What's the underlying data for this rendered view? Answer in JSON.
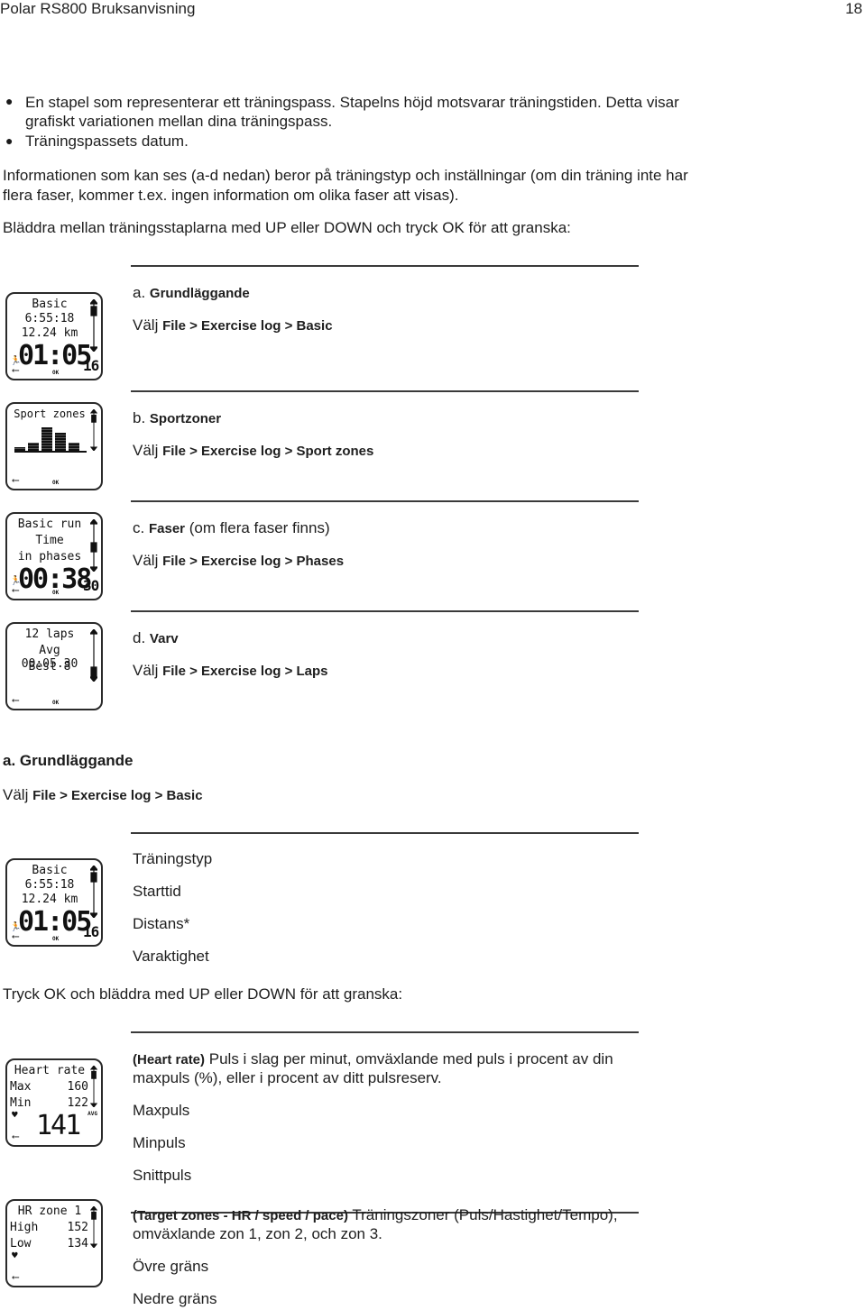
{
  "header": {
    "title": "Polar RS800 Bruksanvisning",
    "page_number": "18"
  },
  "intro": {
    "bullets": [
      "En stapel som representerar ett träningspass. Stapelns höjd motsvarar träningstiden. Detta visar",
      "grafiskt variationen mellan dina träningspass.",
      "Träningspassets datum."
    ],
    "para1_line1": "Informationen som kan ses (a-d nedan) beror på träningstyp och inställningar (om din träning inte har",
    "para1_line2": "flera faser, kommer t.ex. ingen information om olika faser att visas).",
    "para2": "Bläddra mellan träningsstaplarna med UP eller DOWN och tryck OK för att granska:"
  },
  "options": [
    {
      "letter": "a.",
      "title": "Grundläggande",
      "extra": "",
      "choose": "Välj",
      "path": "File > Exercise log > Basic"
    },
    {
      "letter": "b.",
      "title": "Sportzoner",
      "extra": "",
      "choose": "Välj",
      "path": "File > Exercise log > Sport zones"
    },
    {
      "letter": "c.",
      "title": "Faser",
      "extra": "(om flera faser finns)",
      "choose": "Välj",
      "path": "File > Exercise log > Phases"
    },
    {
      "letter": "d.",
      "title": "Varv",
      "extra": "",
      "choose": "Välj",
      "path": "File > Exercise log > Laps"
    }
  ],
  "watches": {
    "basic": {
      "l1": "Basic",
      "l2": "6:55:18",
      "l3": "12.24 km",
      "big": "01:05",
      "small": "16",
      "ok": "OK"
    },
    "sport": {
      "l1": "Sport zones",
      "ok": "OK",
      "zone_bars": [
        0.15,
        0.35,
        1.0,
        0.75,
        0.35
      ]
    },
    "phases": {
      "l1": "Basic run",
      "l2": "Time",
      "l3": "in phases",
      "big": "00:38",
      "small": "30",
      "ok": "OK"
    },
    "laps": {
      "l1": "12 laps",
      "l2": "Avg 00:05.30",
      "l3": "Best 8",
      "ok": "OK"
    },
    "heartrate": {
      "l1": "Heart rate",
      "max_label": "Max",
      "max_val": "160",
      "min_label": "Min",
      "min_val": "122",
      "avg_label": "AVG",
      "big": "141"
    },
    "hrzone": {
      "l1": "HR zone 1",
      "high_label": "High",
      "high_val": "152",
      "low_label": "Low",
      "low_val": "134"
    }
  },
  "section_a": {
    "title": "a. Grundläggande",
    "choose": "Välj",
    "path": "File > Exercise log > Basic",
    "fields": [
      "Träningstyp",
      "Starttid",
      "Distans*",
      "Varaktighet"
    ],
    "instruction": "Tryck OK och bläddra med UP eller DOWN för att granska:"
  },
  "heart_rate": {
    "bold": "(Heart rate)",
    "desc_line1": "Puls i slag per minut, omväxlande med puls i procent av din",
    "desc_line2": "maxpuls (%), eller i procent av ditt pulsreserv.",
    "items": [
      "Maxpuls",
      "Minpuls",
      "Snittpuls"
    ]
  },
  "target_zones": {
    "bold": "(Target zones - HR / speed / pace)",
    "desc_line1": "Träningszoner (Puls/Hastighet/Tempo),",
    "desc_line2": "omväxlande zon 1, zon 2, och zon 3.",
    "items": [
      "Övre gräns",
      "Nedre gräns"
    ]
  }
}
